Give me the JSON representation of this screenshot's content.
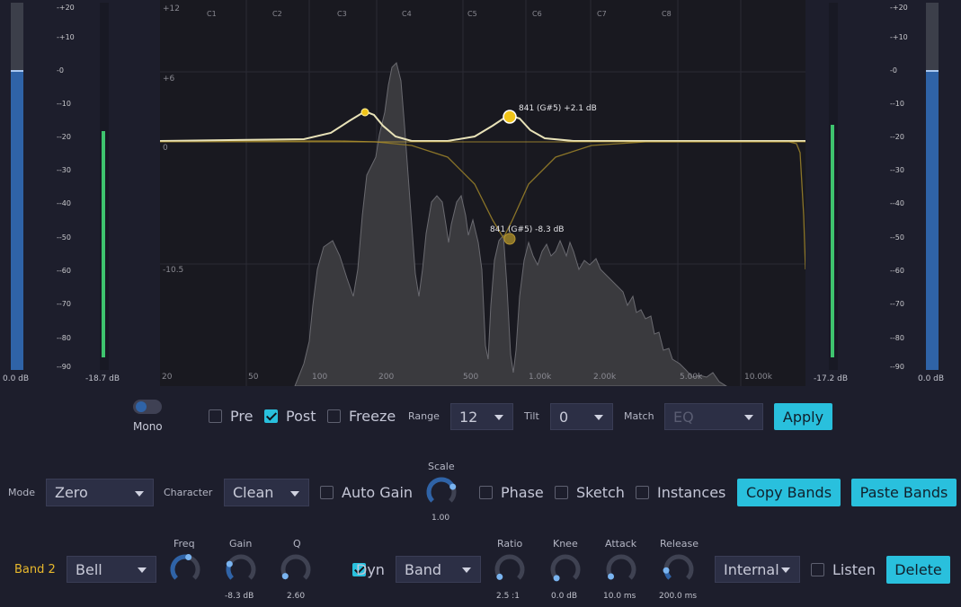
{
  "meters": {
    "left_db": "0.0 dB",
    "left_peak": "-18.7 dB",
    "right_peak": "-17.2 dB",
    "right_db": "0.0 dB",
    "scale": [
      "+20",
      "+10",
      "0",
      "-10",
      "-20",
      "-30",
      "-40",
      "-50",
      "-60",
      "-70",
      "-80",
      "-90"
    ],
    "left_level": 0.8,
    "right_level": 0.8
  },
  "graph": {
    "top_notes": [
      "C1",
      "C2",
      "C3",
      "C4",
      "C5",
      "C6",
      "C7",
      "C8"
    ],
    "db_labels": [
      "+12",
      "+6",
      "0",
      "-10.5"
    ],
    "freq_labels": [
      "20",
      "50",
      "100",
      "200",
      "500",
      "1.00k",
      "2.00k",
      "5.00k",
      "10.00k"
    ],
    "band_label_upper": "841 (G#5) +2.1 dB",
    "band_label_lower": "841 (G#5) -8.3 dB",
    "accent": "#f0c419"
  },
  "toolbar": {
    "mono_label": "Mono",
    "pre_label": "Pre",
    "post_label": "Post",
    "freeze_label": "Freeze",
    "range_label": "Range",
    "range_value": "12",
    "tilt_label": "Tilt",
    "tilt_value": "0",
    "match_label": "Match",
    "match_value": "EQ",
    "apply_label": "Apply"
  },
  "settings": {
    "mode_label": "Mode",
    "mode_value": "Zero",
    "character_label": "Character",
    "character_value": "Clean",
    "auto_gain_label": "Auto Gain",
    "scale_label": "Scale",
    "scale_value": "1.00",
    "phase_label": "Phase",
    "sketch_label": "Sketch",
    "instances_label": "Instances",
    "copy_bands_label": "Copy Bands",
    "paste_bands_label": "Paste Bands"
  },
  "band": {
    "name": "Band 2",
    "type_value": "Bell",
    "freq_label": "Freq",
    "gain_label": "Gain",
    "gain_value": "-8.3 dB",
    "q_label": "Q",
    "q_value": "2.60",
    "dyn_label": "Dyn",
    "dyn_mode_value": "Band",
    "ratio_label": "Ratio",
    "ratio_value": "2.5 :1",
    "knee_label": "Knee",
    "knee_value": "0.0 dB",
    "attack_label": "Attack",
    "attack_value": "10.0 ms",
    "release_label": "Release",
    "release_value": "200.0 ms",
    "sidechain_value": "Internal",
    "listen_label": "Listen",
    "delete_label": "Delete",
    "name_color": "#e9b92c"
  }
}
